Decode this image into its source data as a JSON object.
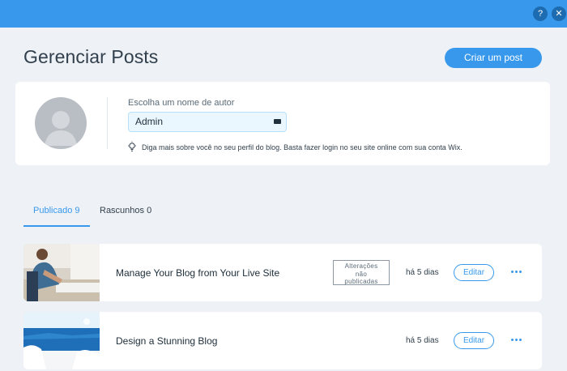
{
  "window": {
    "help_label": "?",
    "close_label": "✕",
    "accent_color": "#3899ec"
  },
  "header": {
    "title": "Gerenciar Posts",
    "create_button": "Criar um post"
  },
  "author": {
    "label": "Escolha um nome de autor",
    "name_value": "Admin",
    "tip": "Diga mais sobre você no seu perfil do blog. Basta fazer login no seu site online com sua conta Wix."
  },
  "tabs": [
    {
      "label": "Publicado 9",
      "active": true
    },
    {
      "label": "Rascunhos 0",
      "active": false
    }
  ],
  "posts": [
    {
      "title": "Manage Your Blog from Your Live Site",
      "badge": [
        "Alterações",
        "não",
        "publicadas"
      ],
      "date": "há 5 dias",
      "edit_label": "Editar",
      "thumbnail": "person-working-at-desk-photo"
    },
    {
      "title": "Design a Stunning Blog",
      "date": "há 5 dias",
      "edit_label": "Editar",
      "thumbnail": "santorini-sea-view-photo"
    }
  ]
}
